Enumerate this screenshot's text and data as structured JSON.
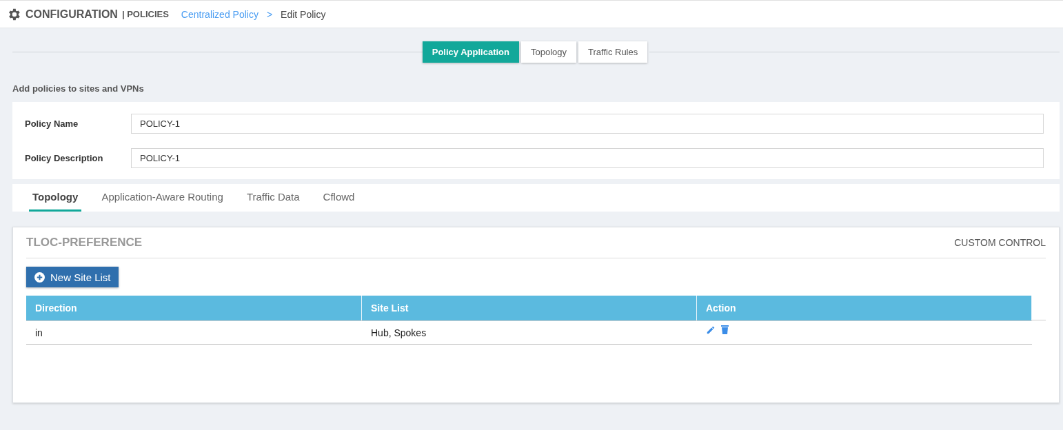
{
  "header": {
    "title": "CONFIGURATION",
    "section": "| POLICIES",
    "breadcrumb": [
      {
        "label": "Centralized Policy",
        "link": true
      },
      {
        "label": "Edit Policy",
        "link": false
      }
    ],
    "separator": ">"
  },
  "steps": [
    {
      "label": "Policy Application",
      "selected": true
    },
    {
      "label": "Topology",
      "selected": false
    },
    {
      "label": "Traffic Rules",
      "selected": false
    }
  ],
  "intro": "Add policies to sites and VPNs",
  "form": [
    {
      "label": "Policy Name",
      "value": "POLICY-1"
    },
    {
      "label": "Policy Description",
      "value": "POLICY-1"
    }
  ],
  "tabs": [
    {
      "label": "Topology",
      "selected": true
    },
    {
      "label": "Application-Aware Routing",
      "selected": false
    },
    {
      "label": "Traffic Data",
      "selected": false
    },
    {
      "label": "Cflowd",
      "selected": false
    }
  ],
  "panel": {
    "title": "TLOC-PREFERENCE",
    "type": "CUSTOM CONTROL",
    "button": "New Site List",
    "columns": [
      "Direction",
      "Site List",
      "Action"
    ],
    "rows": [
      {
        "direction": "in",
        "site_list": "Hub, Spokes"
      }
    ]
  }
}
